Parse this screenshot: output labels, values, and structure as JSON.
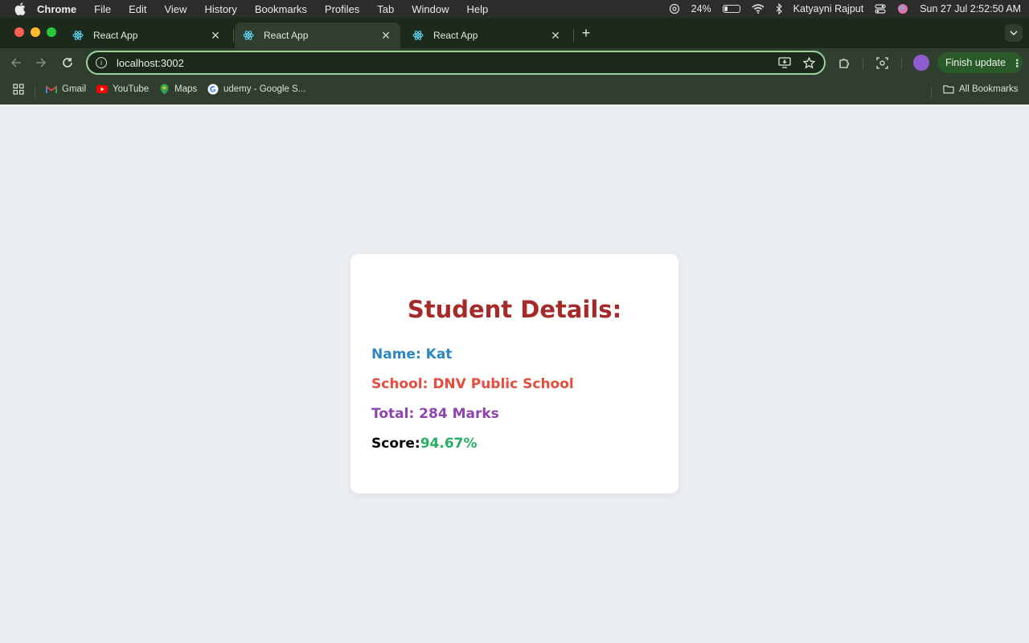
{
  "menubar": {
    "app_name": "Chrome",
    "items": [
      "File",
      "Edit",
      "View",
      "History",
      "Bookmarks",
      "Profiles",
      "Tab",
      "Window",
      "Help"
    ],
    "battery_percent": "24%",
    "battery_level": 0.24,
    "user_name": "Katyayni Rajput",
    "datetime": "Sun 27 Jul  2:52:50 AM"
  },
  "tabs": [
    {
      "title": "React App",
      "active": false,
      "icon": "react-icon"
    },
    {
      "title": "React App",
      "active": true,
      "icon": "react-icon"
    },
    {
      "title": "React App",
      "active": false,
      "icon": "react-icon"
    }
  ],
  "omnibox": {
    "url": "localhost:3002"
  },
  "toolbar": {
    "finish_update_label": "Finish update"
  },
  "bookmarks": {
    "items": [
      {
        "label": "Gmail",
        "icon": "gmail-icon"
      },
      {
        "label": "YouTube",
        "icon": "youtube-icon"
      },
      {
        "label": "Maps",
        "icon": "maps-icon"
      },
      {
        "label": "udemy - Google S...",
        "icon": "google-icon"
      }
    ],
    "all_bookmarks_label": "All Bookmarks"
  },
  "card": {
    "title": "Student Details:",
    "name": "Name: Kat",
    "school": "School: DNV Public School",
    "total": "Total: 284 Marks",
    "score_label": "Score:",
    "score_value": "94.67%"
  },
  "colors": {
    "title": "#a52a2a",
    "name": "#2e86c1",
    "school": "#e74c3c",
    "total": "#8e44ad",
    "score_label": "#000000",
    "score_value": "#27ae60",
    "page_background": "#ebeff2"
  }
}
